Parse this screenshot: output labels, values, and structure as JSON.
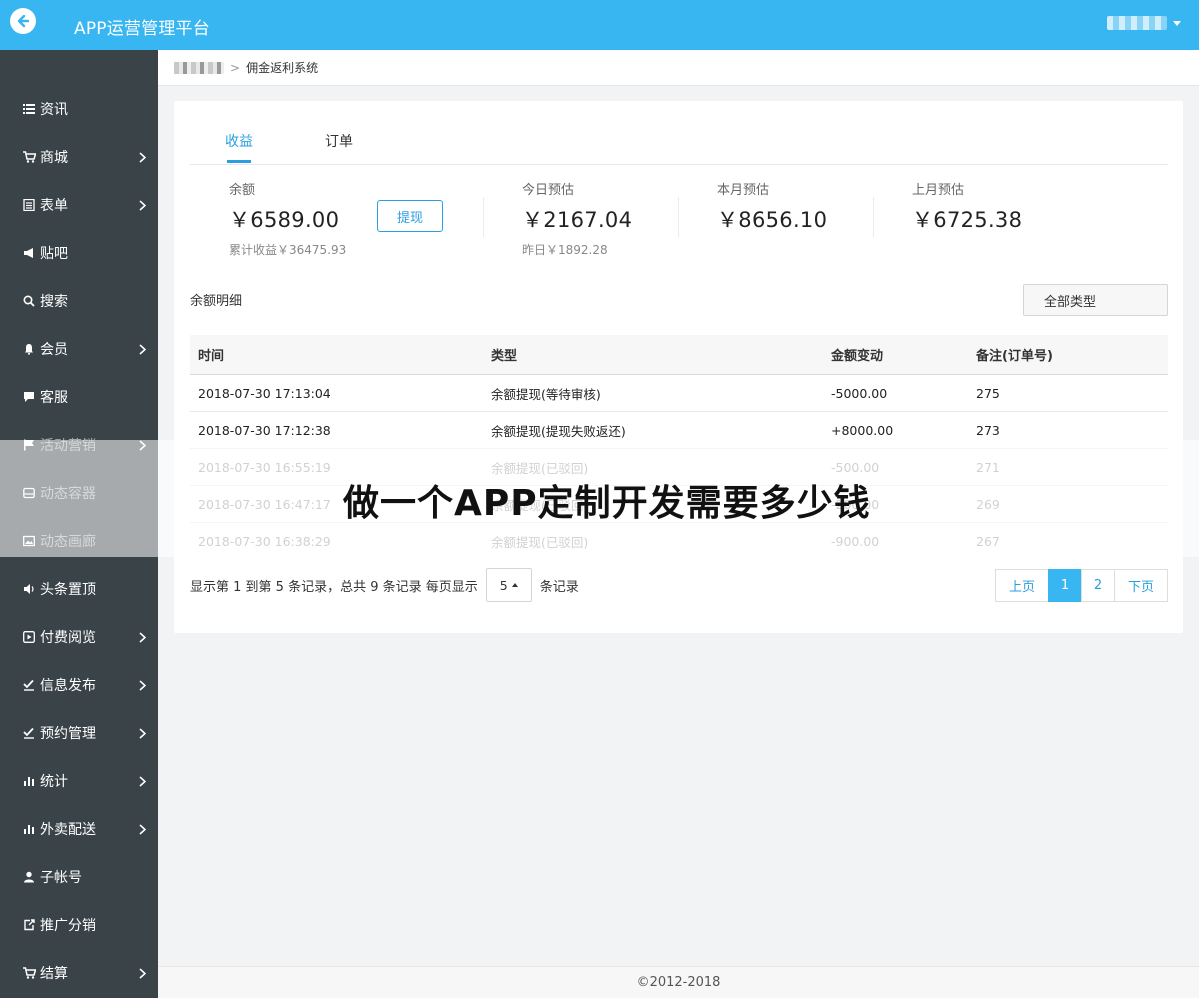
{
  "app": {
    "title": "APP运营管理平台",
    "copyright": "©2012-2018"
  },
  "breadcrumb": {
    "current": "佣金返利系统"
  },
  "sidebar": {
    "items": [
      {
        "label": "资讯",
        "icon": "list-icon",
        "has_chevron": false
      },
      {
        "label": "商城",
        "icon": "cart-icon",
        "has_chevron": true
      },
      {
        "label": "表单",
        "icon": "form-icon",
        "has_chevron": true
      },
      {
        "label": "贴吧",
        "icon": "megaphone-icon",
        "has_chevron": false
      },
      {
        "label": "搜索",
        "icon": "search-icon",
        "has_chevron": false
      },
      {
        "label": "会员",
        "icon": "bell-icon",
        "has_chevron": true
      },
      {
        "label": "客服",
        "icon": "chat-icon",
        "has_chevron": false
      },
      {
        "label": "活动营销",
        "icon": "flag-icon",
        "has_chevron": true
      },
      {
        "label": "动态容器",
        "icon": "hdd-icon",
        "has_chevron": false
      },
      {
        "label": "动态画廊",
        "icon": "picture-icon",
        "has_chevron": false
      },
      {
        "label": "头条置顶",
        "icon": "volume-icon",
        "has_chevron": false
      },
      {
        "label": "付费阅览",
        "icon": "play-square-icon",
        "has_chevron": true
      },
      {
        "label": "信息发布",
        "icon": "check-edit-icon",
        "has_chevron": true
      },
      {
        "label": "预约管理",
        "icon": "check-edit-icon",
        "has_chevron": true
      },
      {
        "label": "统计",
        "icon": "bar-chart-icon",
        "has_chevron": true
      },
      {
        "label": "外卖配送",
        "icon": "bar-chart-icon",
        "has_chevron": true
      },
      {
        "label": "子帐号",
        "icon": "user-icon",
        "has_chevron": false
      },
      {
        "label": "推广分销",
        "icon": "share-icon",
        "has_chevron": false
      },
      {
        "label": "结算",
        "icon": "cart-icon",
        "has_chevron": true
      }
    ]
  },
  "tabs": [
    {
      "label": "收益"
    },
    {
      "label": "订单"
    }
  ],
  "stats": {
    "balance": {
      "label": "余额",
      "value": "￥6589.00",
      "sub": "累计收益￥36475.93",
      "button": "提现"
    },
    "today": {
      "label": "今日预估",
      "value": "￥2167.04",
      "sub": "昨日￥1892.28"
    },
    "month": {
      "label": "本月预估",
      "value": "￥8656.10"
    },
    "last_month": {
      "label": "上月预估",
      "value": "￥6725.38"
    }
  },
  "detail": {
    "title": "余额明细",
    "type_filter": "全部类型"
  },
  "table": {
    "headers": [
      "时间",
      "类型",
      "金额变动",
      "备注(订单号)"
    ],
    "rows": [
      [
        "2018-07-30 17:13:04",
        "余额提现(等待审核)",
        "-5000.00",
        "275"
      ],
      [
        "2018-07-30 17:12:38",
        "余额提现(提现失败返还)",
        "+8000.00",
        "273"
      ],
      [
        "2018-07-30 16:55:19",
        "余额提现(已驳回)",
        "-500.00",
        "271"
      ],
      [
        "2018-07-30 16:47:17",
        "余额提现(已驳回)",
        "-200.00",
        "269"
      ],
      [
        "2018-07-30 16:38:29",
        "余额提现(已驳回)",
        "-900.00",
        "267"
      ]
    ]
  },
  "pager": {
    "info_prefix": "显示第 1 到第 5 条记录，总共 9 条记录 每页显示",
    "page_size": "5",
    "info_suffix": "条记录",
    "prev": "上页",
    "pages": [
      "1",
      "2"
    ],
    "next": "下页",
    "current": "1"
  },
  "overlay": {
    "text": "做一个APP定制开发需要多少钱"
  },
  "colors": {
    "topbar": "#37b6f2",
    "sidebar": "#3a4348",
    "accent": "#2a9fe0"
  }
}
